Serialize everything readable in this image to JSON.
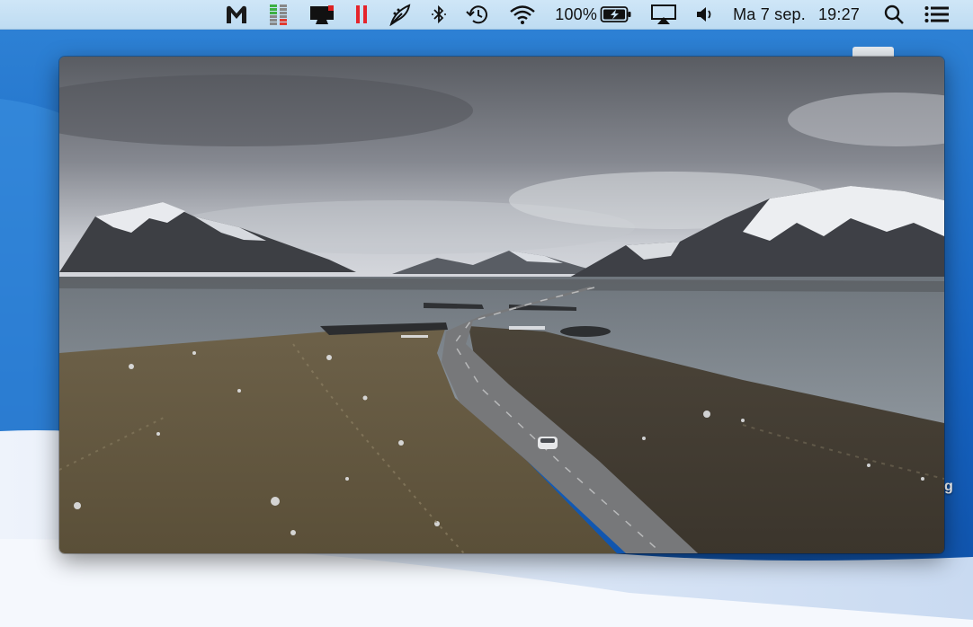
{
  "menubar": {
    "items": [
      {
        "name": "malwarebytes-icon"
      },
      {
        "name": "istat-stack-icon"
      },
      {
        "name": "display-screen-icon"
      },
      {
        "name": "pause-bars-icon"
      },
      {
        "name": "feather-pen-icon"
      },
      {
        "name": "bluetooth-icon"
      },
      {
        "name": "time-machine-icon"
      },
      {
        "name": "wifi-icon"
      }
    ],
    "battery_percent": "100%",
    "airplay": "airplay-icon",
    "volume": "volume-icon",
    "date": "Ma 7 sep.",
    "time": "19:27",
    "search": "spotlight-search-icon",
    "notifications": "notification-center-icon",
    "colors": {
      "bar": "#c6e1f5",
      "pause": "#e5242b"
    }
  },
  "desktop": {
    "partial_label": "g"
  },
  "video": {
    "description_icon": "landscape-video-frame"
  }
}
